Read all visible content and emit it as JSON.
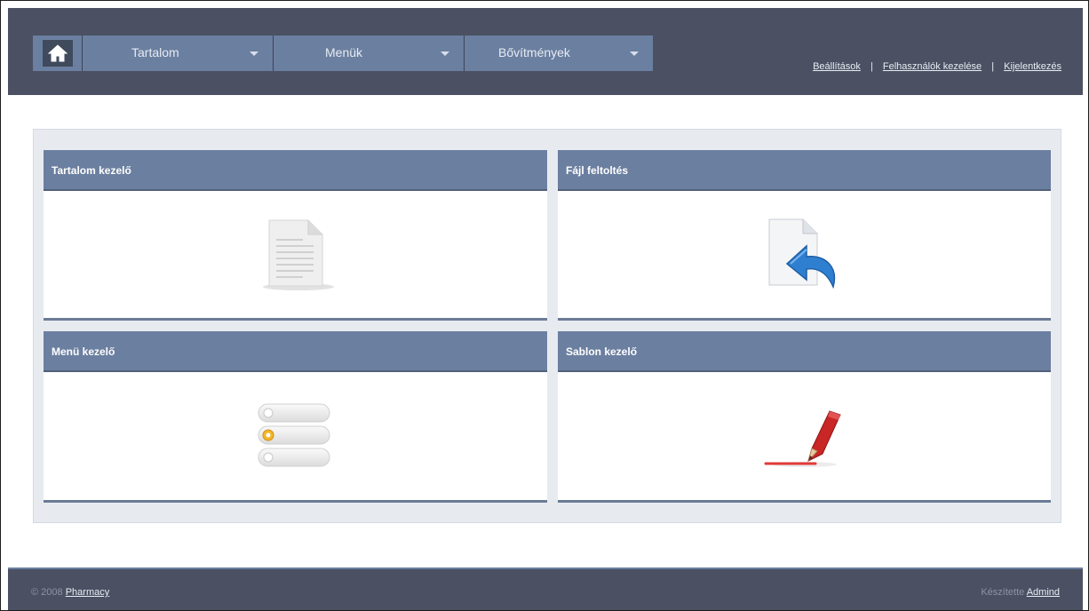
{
  "nav": {
    "home_icon": "home-icon",
    "items": [
      {
        "label": "Tartalom"
      },
      {
        "label": "Menük"
      },
      {
        "label": "Bővítmények"
      }
    ]
  },
  "top_links": [
    {
      "label": "Beállítások"
    },
    {
      "label": "Felhasználók kezelése"
    },
    {
      "label": "Kijelentkezés"
    }
  ],
  "separator": "|",
  "cards": [
    {
      "title": "Tartalom kezelő",
      "icon": "document-icon"
    },
    {
      "title": "Fájl feltoltés",
      "icon": "file-upload-icon"
    },
    {
      "title": "Menü kezelő",
      "icon": "menu-list-icon"
    },
    {
      "title": "Sablon kezelő",
      "icon": "pencil-icon"
    }
  ],
  "footer": {
    "copyright": "© 2008",
    "site_link": "Pharmacy",
    "made_by": "Készítette",
    "author_link": "Admind"
  },
  "colors": {
    "header_bg": "#4b5163",
    "nav_bg": "#6b7fa0",
    "panel_bg": "#e7ebf0"
  }
}
